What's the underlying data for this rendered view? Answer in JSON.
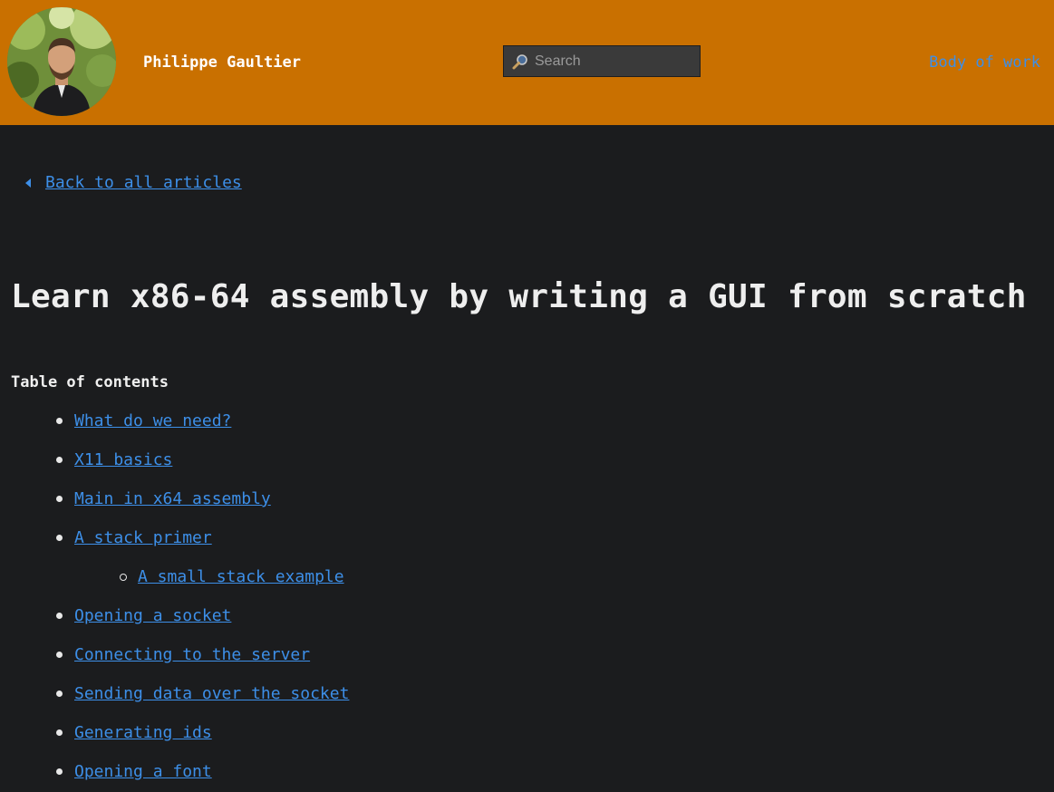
{
  "header": {
    "author_name": "Philippe Gaultier",
    "search_placeholder": "Search",
    "nav_link": "Body of work",
    "background_color": "#c97000"
  },
  "back_link": "Back to all articles",
  "article": {
    "title": "Learn x86-64 assembly by writing a GUI from scratch"
  },
  "toc": {
    "heading": "Table of contents",
    "items": [
      {
        "label": "What do we need?",
        "level": 1
      },
      {
        "label": "X11 basics",
        "level": 1
      },
      {
        "label": "Main in x64 assembly",
        "level": 1
      },
      {
        "label": "A stack primer",
        "level": 1
      },
      {
        "label": "A small stack example",
        "level": 2
      },
      {
        "label": "Opening a socket",
        "level": 1
      },
      {
        "label": "Connecting to the server",
        "level": 1
      },
      {
        "label": "Sending data over the socket",
        "level": 1
      },
      {
        "label": "Generating ids",
        "level": 1
      },
      {
        "label": "Opening a font",
        "level": 1
      }
    ]
  },
  "colors": {
    "page_background": "#1b1c1e",
    "link": "#3d8fe8",
    "text": "#eeeeee"
  },
  "icons": {
    "back": "caret-left-icon",
    "search": "magnifier-icon",
    "avatar": "author-photo"
  }
}
